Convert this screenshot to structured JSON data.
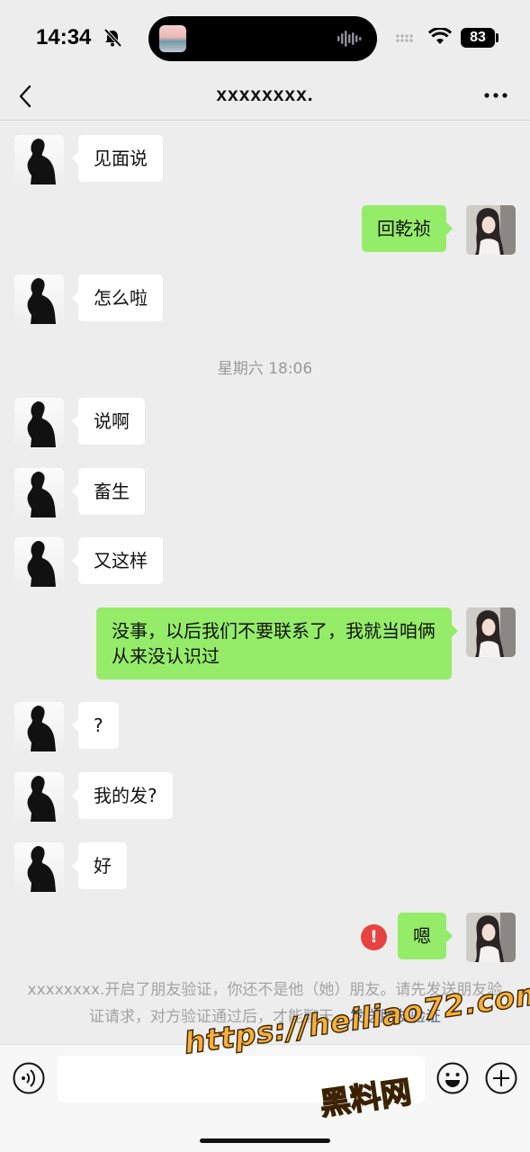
{
  "status_bar": {
    "time": "14:34",
    "battery": "83",
    "icons": [
      "bell-muted-icon",
      "audio-wave-icon",
      "cellular-signal-icon",
      "wifi-icon",
      "battery-icon"
    ]
  },
  "nav": {
    "title": "xxxxxxxx.",
    "back_icon": "chevron-left-icon",
    "more_icon": "more-dots-icon"
  },
  "messages": [
    {
      "sender": "contact",
      "text": "见面说"
    },
    {
      "sender": "me",
      "text": "回乾祯"
    },
    {
      "sender": "contact",
      "text": "怎么啦"
    },
    {
      "sender": "contact",
      "text": "说啊"
    },
    {
      "sender": "contact",
      "text": "畜生"
    },
    {
      "sender": "contact",
      "text": "又这样"
    },
    {
      "sender": "me",
      "text": "没事，以后我们不要联系了，我就当咱俩从来没认识过"
    },
    {
      "sender": "contact",
      "text": "?"
    },
    {
      "sender": "contact",
      "text": "我的发?"
    },
    {
      "sender": "contact",
      "text": "好"
    },
    {
      "sender": "me",
      "text": "嗯",
      "status": "failed"
    }
  ],
  "timestamp": "星期六 18:06",
  "system_notice": {
    "text": "xxxxxxxx.开启了朋友验证，你还不是他（她）朋友。请先发送朋友验证请求，对方验证通过后，才能聊天。",
    "link": "发送朋友验证"
  },
  "error_mark": "!",
  "input_bar": {
    "placeholder": "",
    "icons": [
      "voice-icon",
      "emoji-icon",
      "plus-icon"
    ]
  },
  "watermark": {
    "url": "https://heiliao72.com",
    "name": "黑料网"
  },
  "colors": {
    "background": "#ededed",
    "incoming_bubble": "#ffffff",
    "outgoing_bubble": "#95ec69",
    "error": "#e64340",
    "link": "#576b95"
  }
}
